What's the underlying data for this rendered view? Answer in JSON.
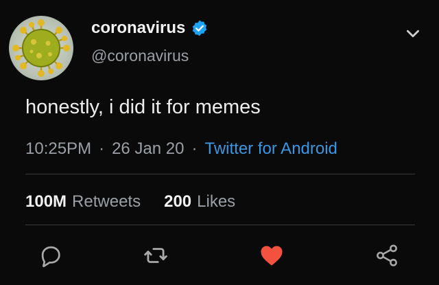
{
  "author": {
    "display_name": "coronavirus",
    "handle": "@coronavirus",
    "verified": true,
    "avatar_icon": "virus-icon"
  },
  "tweet": {
    "text": "honestly, i did it for memes",
    "time": "10:25PM",
    "separator": "·",
    "date": "26 Jan 20",
    "client": "Twitter for Android"
  },
  "stats": {
    "retweets_count": "100M",
    "retweets_label": "Retweets",
    "likes_count": "200",
    "likes_label": "Likes"
  },
  "actions": {
    "reply_icon": "reply-icon",
    "retweet_icon": "retweet-icon",
    "like_icon": "heart-icon",
    "share_icon": "share-icon",
    "menu_icon": "chevron-down-icon"
  },
  "colors": {
    "background": "#0a0a0a",
    "link": "#3b97e3",
    "verified": "#1da1f2",
    "like": "#e0245e",
    "muted": "#9aa0a6"
  }
}
